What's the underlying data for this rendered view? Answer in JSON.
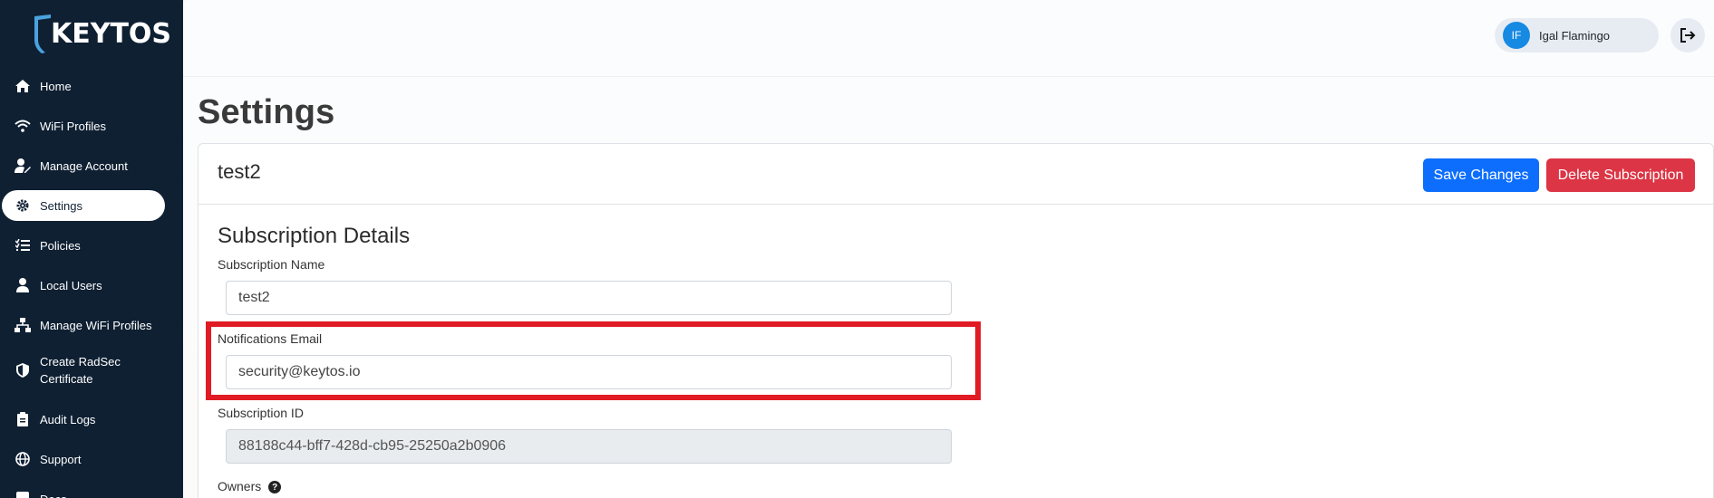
{
  "app": {
    "brand": "KEYTOS"
  },
  "sidebar": {
    "items": [
      {
        "label": "Home",
        "icon": "home-icon"
      },
      {
        "label": "WiFi Profiles",
        "icon": "wifi-icon"
      },
      {
        "label": "Manage Account",
        "icon": "user-edit-icon"
      },
      {
        "label": "Settings",
        "icon": "gear-icon",
        "active": true
      },
      {
        "label": "Policies",
        "icon": "list-check-icon"
      },
      {
        "label": "Local Users",
        "icon": "user-icon"
      },
      {
        "label": "Manage WiFi Profiles",
        "icon": "network-icon"
      },
      {
        "label": "Create RadSec Certificate",
        "icon": "shield-icon"
      },
      {
        "label": "Audit Logs",
        "icon": "clipboard-icon"
      },
      {
        "label": "Support",
        "icon": "globe-icon"
      },
      {
        "label": "Docs",
        "icon": "book-icon"
      }
    ]
  },
  "topbar": {
    "user_initials": "IF",
    "user_name": "Igal Flamingo",
    "logout_icon": "logout-icon"
  },
  "page": {
    "title": "Settings"
  },
  "card": {
    "title": "test2",
    "save_label": "Save Changes",
    "delete_label": "Delete Subscription",
    "section_title": "Subscription Details",
    "fields": {
      "subscription_name_label": "Subscription Name",
      "subscription_name_value": "test2",
      "notifications_email_label": "Notifications Email",
      "notifications_email_value": "security@keytos.io",
      "subscription_id_label": "Subscription ID",
      "subscription_id_value": "88188c44-bff7-428d-cb95-25250a2b0906",
      "owners_label": "Owners"
    }
  },
  "colors": {
    "sidebar_bg": "#0f2033",
    "primary": "#0d6efd",
    "danger": "#dc3545",
    "highlight": "#e01b24"
  }
}
